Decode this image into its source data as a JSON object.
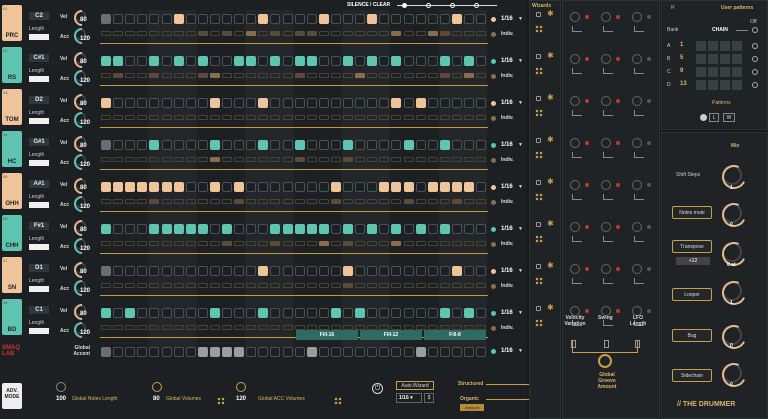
{
  "header": {
    "silence_clear": "SILENCE / CLEAR"
  },
  "tracks": [
    {
      "name": "PRC",
      "note": "C2",
      "vel": "80",
      "acc": "120",
      "rate": "1/16",
      "mode": "Indiv.",
      "color": "or",
      "num": "01"
    },
    {
      "name": "RS",
      "note": "C#1",
      "vel": "80",
      "acc": "120",
      "rate": "1/16",
      "mode": "Indiv.",
      "color": "tl",
      "num": "02"
    },
    {
      "name": "TOM",
      "note": "D2",
      "vel": "80",
      "acc": "120",
      "rate": "1/16",
      "mode": "Indiv.",
      "color": "or",
      "num": "03"
    },
    {
      "name": "HC",
      "note": "G#1",
      "vel": "80",
      "acc": "120",
      "rate": "1/16",
      "mode": "Indiv.",
      "color": "tl",
      "num": "04"
    },
    {
      "name": "OHH",
      "note": "A#1",
      "vel": "80",
      "acc": "120",
      "rate": "1/16",
      "mode": "Indiv.",
      "color": "or",
      "num": "05"
    },
    {
      "name": "CHH",
      "note": "F#1",
      "vel": "80",
      "acc": "120",
      "rate": "1/16",
      "mode": "Indiv.",
      "color": "tl",
      "num": "06"
    },
    {
      "name": "SN",
      "note": "D1",
      "vel": "80",
      "acc": "120",
      "rate": "1/16",
      "mode": "Indiv.",
      "color": "or",
      "num": "07"
    },
    {
      "name": "BD",
      "note": "C1",
      "vel": "80",
      "acc": "120",
      "rate": "1/16",
      "mode": "Indiv.",
      "color": "tl",
      "num": "08"
    }
  ],
  "labels": {
    "vel": "Vel",
    "acc": "Acc",
    "length": "Length"
  },
  "fills": [
    "Fill-16",
    "Fill-12",
    "Fill-8"
  ],
  "global_accent": {
    "label": "Global\nAccent",
    "rate": "1/16"
  },
  "bottom": {
    "adv_mode": "ADV.\nMODE",
    "logo": "SMAQ\nLAB",
    "notes_len_val": "100",
    "notes_len_label": "Global Notes Length",
    "vol_val": "80",
    "vol_label": "Global Volumes",
    "acc_val": "120",
    "acc_label": "Global ACC Volumes",
    "autowizard": "Auto.Wizard",
    "aw_rate": "1/16",
    "aw_dollar": "$",
    "structured": "Structured",
    "organic": "Organic",
    "amount": "Amount"
  },
  "wizards": {
    "title": "Wizards"
  },
  "groove": {
    "velocity_variation": "Velocity\nVariation",
    "swing": "Swing",
    "lfo_length": "LFO\nLength",
    "global_groove": "Global\nGroove\nAmount"
  },
  "user_patterns": {
    "r": "R",
    "title": "User patterns",
    "bank": "Bank",
    "off": "Off",
    "chain": "CHAIN",
    "banks": [
      {
        "letter": "A",
        "num": "1"
      },
      {
        "letter": "B",
        "num": "5"
      },
      {
        "letter": "C",
        "num": "9"
      },
      {
        "letter": "D",
        "num": "13"
      }
    ],
    "patterns": "Patterns",
    "l": "L",
    "w": "W"
  },
  "mix": {
    "title": "Mix",
    "shift_steps": "Shift Steps",
    "shift_val": "1",
    "notes_mute": "Notes mute",
    "notes_mute_val": "0",
    "transpose": "Transpose",
    "transpose_val": "0 st",
    "transpose_badge": "+12",
    "looper": "Looper",
    "looper_val": "1",
    "bug": "Bug",
    "bug_val": "0",
    "sidechain": "Sidechain",
    "sidechain_val": "0"
  },
  "footer": {
    "brand": "// THE DRUMMER"
  }
}
